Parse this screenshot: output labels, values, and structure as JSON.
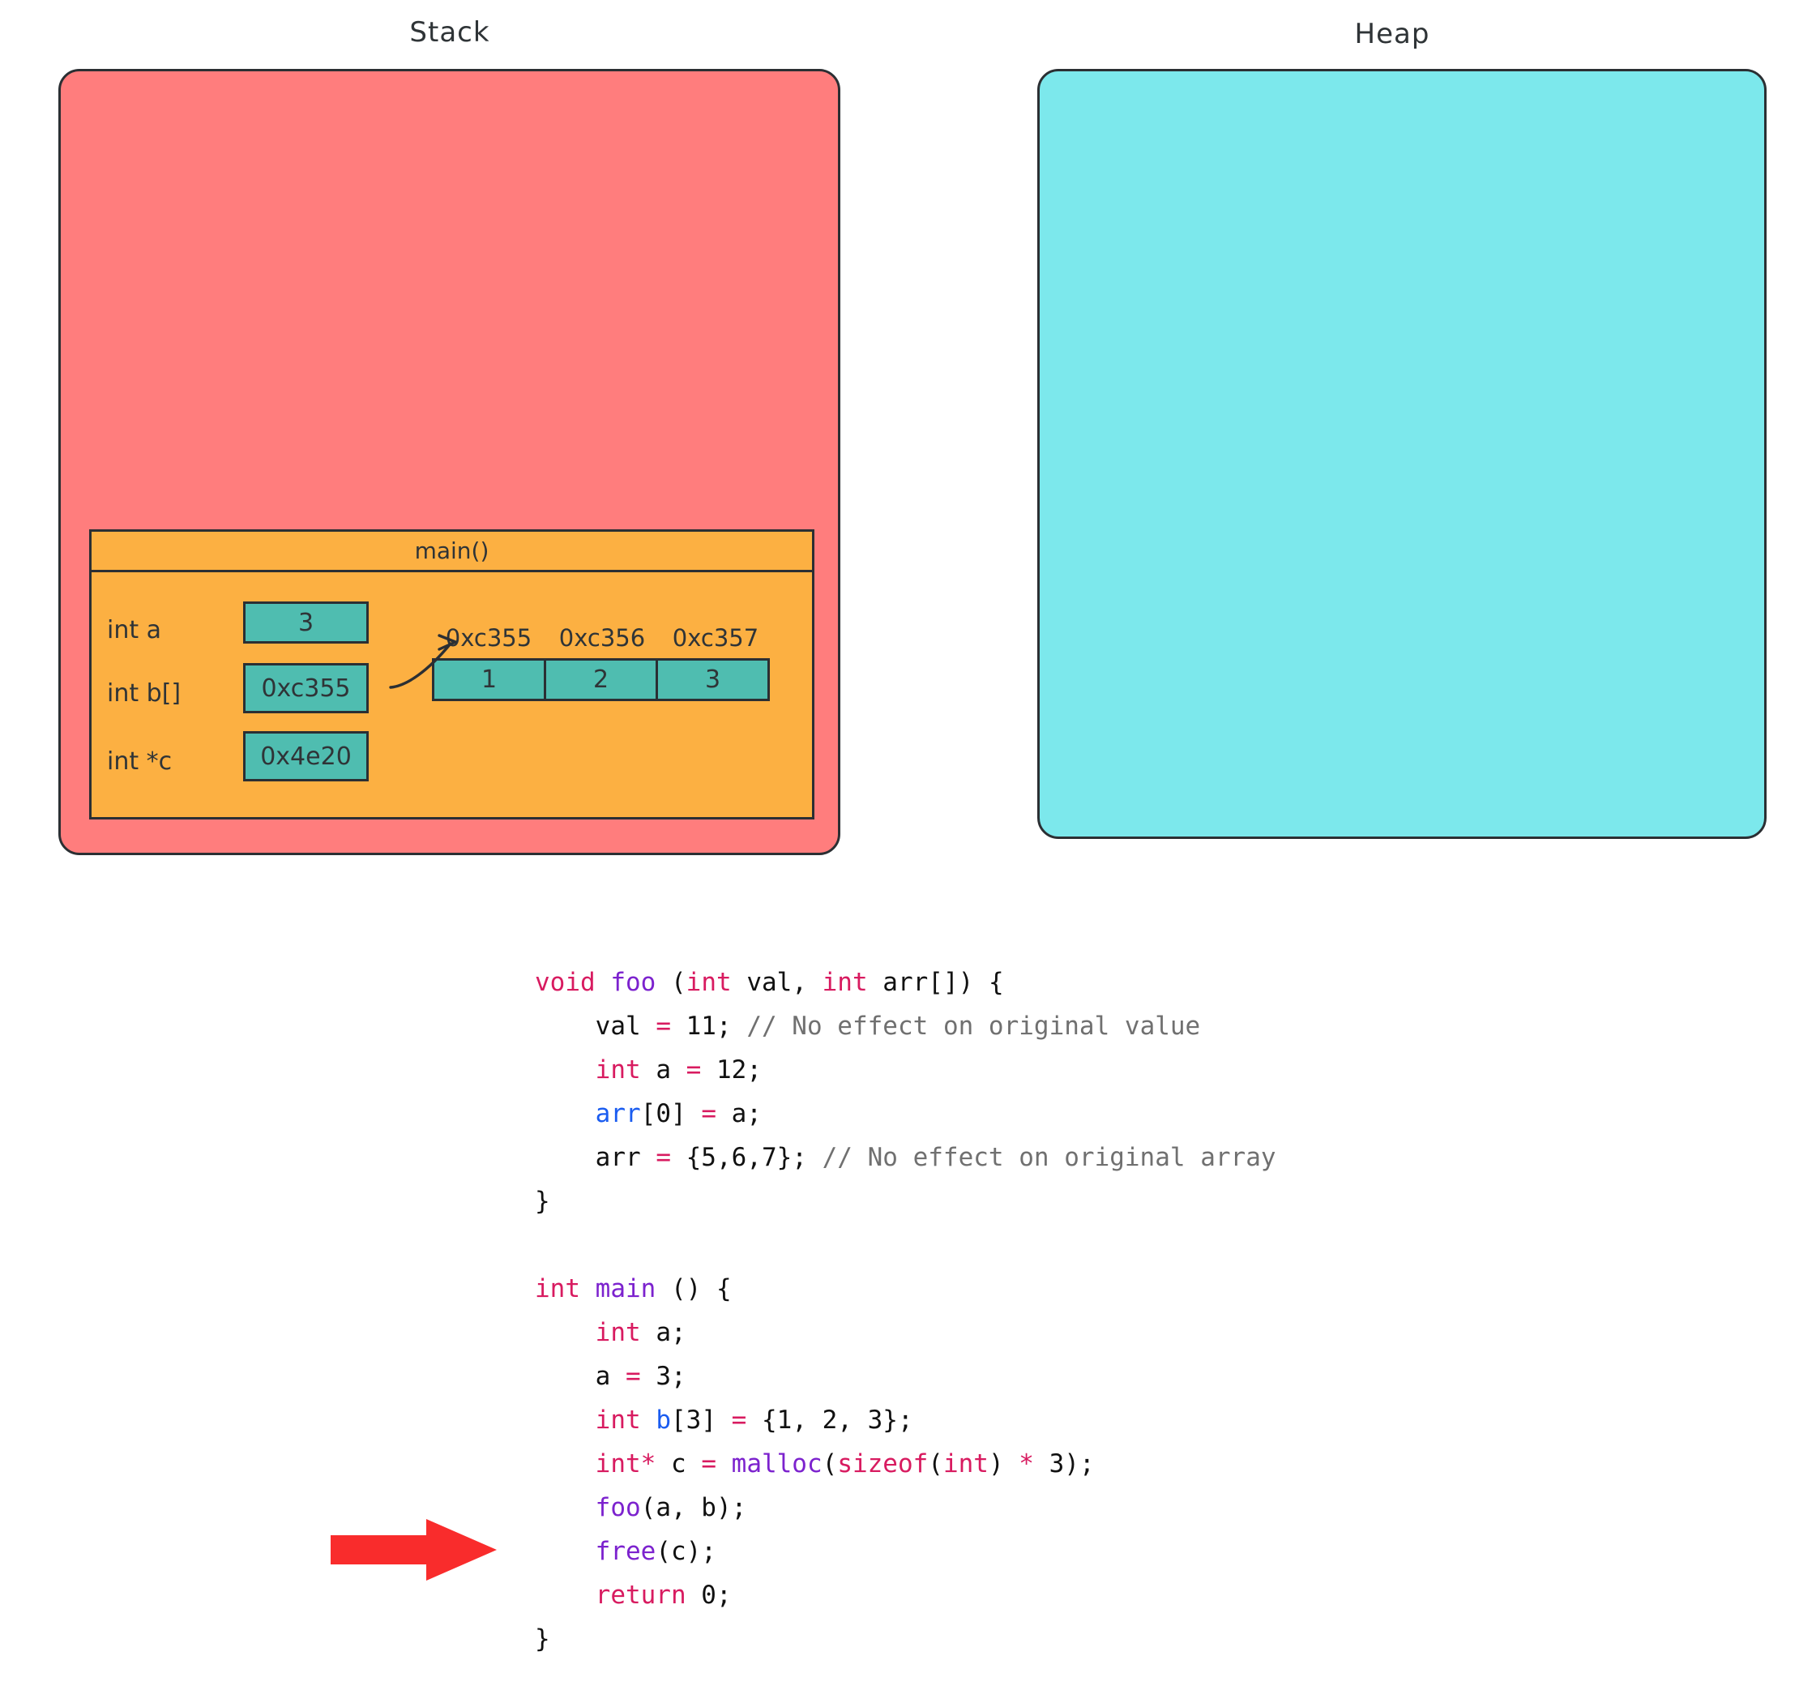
{
  "diagram": {
    "regions": [
      {
        "name": "stack",
        "label": "Stack",
        "color": "#ff7d7d"
      },
      {
        "name": "heap",
        "label": "Heap",
        "color": "#7ce8ec"
      }
    ],
    "stack_frame": {
      "title": "main()",
      "color": "#fcb042",
      "variables": [
        {
          "declaration": "int a",
          "value": "3"
        },
        {
          "declaration": "int b[]",
          "value": "0xc355"
        },
        {
          "declaration": "int *c",
          "value": "0x4e20"
        }
      ],
      "array": {
        "addresses": [
          "0xc355",
          "0xc356",
          "0xc357"
        ],
        "values": [
          "1",
          "2",
          "3"
        ],
        "cell_color": "#4fbdb0"
      }
    },
    "heap_contents": []
  },
  "code": {
    "current_line_marker_color": "#f92c2c",
    "current_line": "free(c);",
    "lines": [
      [
        {
          "t": "void",
          "c": "kw"
        },
        {
          "t": " ",
          "c": "pl"
        },
        {
          "t": "foo",
          "c": "fn"
        },
        {
          "t": " (",
          "c": "pl"
        },
        {
          "t": "int",
          "c": "kw"
        },
        {
          "t": " val, ",
          "c": "pl"
        },
        {
          "t": "int",
          "c": "kw"
        },
        {
          "t": " arr[]) {",
          "c": "pl"
        }
      ],
      [
        {
          "t": "    val ",
          "c": "pl"
        },
        {
          "t": "=",
          "c": "op"
        },
        {
          "t": " 11; ",
          "c": "pl"
        },
        {
          "t": "// No effect on original value",
          "c": "cmt"
        }
      ],
      [
        {
          "t": "    ",
          "c": "pl"
        },
        {
          "t": "int",
          "c": "kw"
        },
        {
          "t": " a ",
          "c": "pl"
        },
        {
          "t": "=",
          "c": "op"
        },
        {
          "t": " 12;",
          "c": "pl"
        }
      ],
      [
        {
          "t": "    ",
          "c": "pl"
        },
        {
          "t": "arr",
          "c": "var"
        },
        {
          "t": "[0] ",
          "c": "pl"
        },
        {
          "t": "=",
          "c": "op"
        },
        {
          "t": " a;",
          "c": "pl"
        }
      ],
      [
        {
          "t": "    arr ",
          "c": "pl"
        },
        {
          "t": "=",
          "c": "op"
        },
        {
          "t": " {5,6,7}; ",
          "c": "pl"
        },
        {
          "t": "// No effect on original array",
          "c": "cmt"
        }
      ],
      [
        {
          "t": "}",
          "c": "pl"
        }
      ],
      [
        {
          "t": " ",
          "c": "pl"
        }
      ],
      [
        {
          "t": "int",
          "c": "kw"
        },
        {
          "t": " ",
          "c": "pl"
        },
        {
          "t": "main",
          "c": "fn"
        },
        {
          "t": " () {",
          "c": "pl"
        }
      ],
      [
        {
          "t": "    ",
          "c": "pl"
        },
        {
          "t": "int",
          "c": "kw"
        },
        {
          "t": " a;",
          "c": "pl"
        }
      ],
      [
        {
          "t": "    a ",
          "c": "pl"
        },
        {
          "t": "=",
          "c": "op"
        },
        {
          "t": " 3;",
          "c": "pl"
        }
      ],
      [
        {
          "t": "    ",
          "c": "pl"
        },
        {
          "t": "int",
          "c": "kw"
        },
        {
          "t": " ",
          "c": "pl"
        },
        {
          "t": "b",
          "c": "var"
        },
        {
          "t": "[3] ",
          "c": "pl"
        },
        {
          "t": "=",
          "c": "op"
        },
        {
          "t": " {1, 2, 3};",
          "c": "pl"
        }
      ],
      [
        {
          "t": "    ",
          "c": "pl"
        },
        {
          "t": "int*",
          "c": "kw"
        },
        {
          "t": " c ",
          "c": "pl"
        },
        {
          "t": "=",
          "c": "op"
        },
        {
          "t": " ",
          "c": "pl"
        },
        {
          "t": "malloc",
          "c": "fn"
        },
        {
          "t": "(",
          "c": "pl"
        },
        {
          "t": "sizeof",
          "c": "kw"
        },
        {
          "t": "(",
          "c": "pl"
        },
        {
          "t": "int",
          "c": "kw"
        },
        {
          "t": ") ",
          "c": "pl"
        },
        {
          "t": "*",
          "c": "op"
        },
        {
          "t": " 3);",
          "c": "pl"
        }
      ],
      [
        {
          "t": "    ",
          "c": "pl"
        },
        {
          "t": "foo",
          "c": "fn"
        },
        {
          "t": "(a, b);",
          "c": "pl"
        }
      ],
      [
        {
          "t": "    ",
          "c": "pl"
        },
        {
          "t": "free",
          "c": "fn"
        },
        {
          "t": "(c);",
          "c": "pl"
        }
      ],
      [
        {
          "t": "    ",
          "c": "pl"
        },
        {
          "t": "return",
          "c": "kw"
        },
        {
          "t": " 0;",
          "c": "pl"
        }
      ],
      [
        {
          "t": "}",
          "c": "pl"
        }
      ]
    ]
  }
}
